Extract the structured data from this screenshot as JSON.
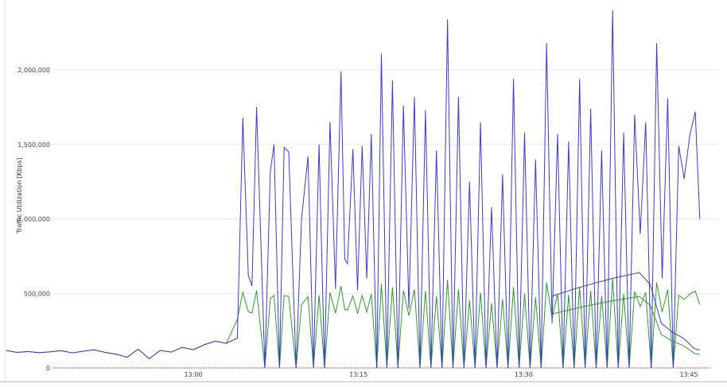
{
  "chart_data": {
    "type": "line",
    "title": "",
    "xlabel": "",
    "ylabel": "Traffic Utilization [Kbps]",
    "xlim": [
      "12:43",
      "13:46"
    ],
    "ylim": [
      0,
      2400000
    ],
    "yticks": [
      0,
      500000,
      1000000,
      1500000,
      2000000
    ],
    "ytick_labels": [
      "0",
      "500,000",
      "1,000,000",
      "1,500,000",
      "2,000,000"
    ],
    "xticks": [
      "13:00",
      "13:15",
      "13:30",
      "13:45"
    ],
    "grid": true,
    "legend": "none",
    "colors": {
      "blue": "#3b3bc9",
      "green": "#2e9a2e",
      "baseline": "#d9534f",
      "grid": "#e8e8e8"
    },
    "series": [
      {
        "color": "#3b3bc9",
        "points": [
          [
            "12:43:00",
            118000
          ],
          [
            "12:44:00",
            104000
          ],
          [
            "12:45:00",
            110000
          ],
          [
            "12:46:00",
            102000
          ],
          [
            "12:47:00",
            108000
          ],
          [
            "12:48:00",
            116000
          ],
          [
            "12:49:00",
            101000
          ],
          [
            "12:50:00",
            112000
          ],
          [
            "12:51:00",
            122000
          ],
          [
            "12:52:00",
            104000
          ],
          [
            "12:53:00",
            92000
          ],
          [
            "12:54:00",
            72000
          ],
          [
            "12:55:00",
            126000
          ],
          [
            "12:56:00",
            62000
          ],
          [
            "12:57:00",
            118000
          ],
          [
            "12:58:00",
            106000
          ],
          [
            "12:59:00",
            138000
          ],
          [
            "13:00:00",
            122000
          ],
          [
            "13:01:00",
            155000
          ],
          [
            "13:02:00",
            180000
          ],
          [
            "13:03:00",
            165000
          ],
          [
            "13:04:00",
            200000
          ],
          [
            "13:04:30",
            1680000
          ],
          [
            "13:05:00",
            620000
          ],
          [
            "13:05:20",
            550000
          ],
          [
            "13:05:45",
            1750000
          ],
          [
            "13:06:30",
            0
          ],
          [
            "13:07:00",
            1320000
          ],
          [
            "13:07:20",
            1500000
          ],
          [
            "13:07:50",
            0
          ],
          [
            "13:08:15",
            1480000
          ],
          [
            "13:08:40",
            1450000
          ],
          [
            "13:09:20",
            0
          ],
          [
            "13:09:50",
            1000000
          ],
          [
            "13:10:25",
            1420000
          ],
          [
            "13:10:55",
            0
          ],
          [
            "13:11:25",
            1500000
          ],
          [
            "13:11:55",
            0
          ],
          [
            "13:12:25",
            1650000
          ],
          [
            "13:12:55",
            530000
          ],
          [
            "13:13:25",
            1990000
          ],
          [
            "13:13:45",
            730000
          ],
          [
            "13:14:00",
            700000
          ],
          [
            "13:14:30",
            1470000
          ],
          [
            "13:14:55",
            520000
          ],
          [
            "13:15:20",
            1490000
          ],
          [
            "13:15:45",
            600000
          ],
          [
            "13:16:10",
            1570000
          ],
          [
            "13:16:40",
            0
          ],
          [
            "13:17:05",
            2110000
          ],
          [
            "13:17:35",
            0
          ],
          [
            "13:18:05",
            1930000
          ],
          [
            "13:18:35",
            0
          ],
          [
            "13:19:05",
            1760000
          ],
          [
            "13:19:35",
            400000
          ],
          [
            "13:20:05",
            1820000
          ],
          [
            "13:20:35",
            0
          ],
          [
            "13:21:05",
            1730000
          ],
          [
            "13:21:35",
            0
          ],
          [
            "13:22:05",
            1460000
          ],
          [
            "13:22:35",
            0
          ],
          [
            "13:23:05",
            2340000
          ],
          [
            "13:23:35",
            0
          ],
          [
            "13:24:05",
            1820000
          ],
          [
            "13:24:35",
            0
          ],
          [
            "13:25:05",
            1250000
          ],
          [
            "13:25:35",
            0
          ],
          [
            "13:26:05",
            1650000
          ],
          [
            "13:26:35",
            0
          ],
          [
            "13:27:05",
            1080000
          ],
          [
            "13:27:35",
            0
          ],
          [
            "13:28:05",
            1300000
          ],
          [
            "13:28:35",
            0
          ],
          [
            "13:29:05",
            1940000
          ],
          [
            "13:29:35",
            0
          ],
          [
            "13:30:05",
            1580000
          ],
          [
            "13:30:35",
            0
          ],
          [
            "13:31:05",
            1400000
          ],
          [
            "13:31:35",
            0
          ],
          [
            "13:32:05",
            2180000
          ],
          [
            "13:32:35",
            300000
          ],
          [
            "13:33:05",
            1570000
          ],
          [
            "13:33:35",
            0
          ],
          [
            "13:34:05",
            1520000
          ],
          [
            "13:34:35",
            0
          ],
          [
            "13:35:05",
            1940000
          ],
          [
            "13:35:35",
            0
          ],
          [
            "13:36:05",
            1740000
          ],
          [
            "13:36:35",
            0
          ],
          [
            "13:37:05",
            1460000
          ],
          [
            "13:37:35",
            0
          ],
          [
            "13:38:05",
            2400000
          ],
          [
            "13:38:35",
            0
          ],
          [
            "13:39:05",
            1580000
          ],
          [
            "13:39:35",
            0
          ],
          [
            "13:40:05",
            1700000
          ],
          [
            "13:40:35",
            900000
          ],
          [
            "13:41:05",
            1650000
          ],
          [
            "13:41:35",
            0
          ],
          [
            "13:42:05",
            2180000
          ],
          [
            "13:42:35",
            600000
          ],
          [
            "13:43:05",
            1810000
          ],
          [
            "13:43:35",
            0
          ],
          [
            "13:44:05",
            1490000
          ],
          [
            "13:44:35",
            1270000
          ],
          [
            "13:45:05",
            1560000
          ],
          [
            "13:45:35",
            1720000
          ],
          [
            "13:46:00",
            1000000
          ]
        ]
      }
    ]
  },
  "chart_points_note": ""
}
